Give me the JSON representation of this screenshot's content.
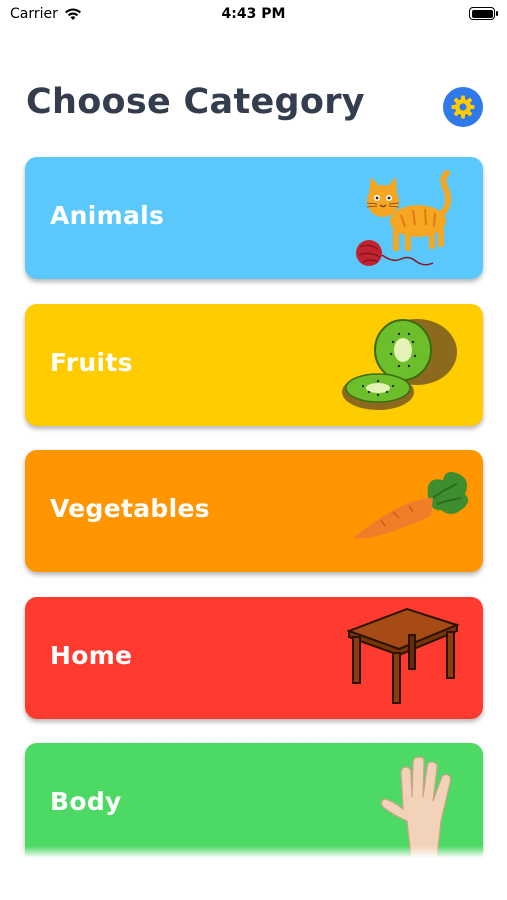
{
  "status_bar": {
    "carrier": "Carrier",
    "time": "4:43 PM"
  },
  "header": {
    "title": "Choose Category"
  },
  "categories": [
    {
      "label": "Animals",
      "color": "#5ac8fa",
      "icon": "cat-icon"
    },
    {
      "label": "Fruits",
      "color": "#ffcc00",
      "icon": "kiwi-icon"
    },
    {
      "label": "Vegetables",
      "color": "#ff9500",
      "icon": "carrot-icon"
    },
    {
      "label": "Home",
      "color": "#ff3b30",
      "icon": "table-icon"
    },
    {
      "label": "Body",
      "color": "#4cd964",
      "icon": "hand-icon"
    }
  ],
  "colors": {
    "title": "#333d4d",
    "settings_button": "#2f79ea",
    "settings_gear": "#ffcc00"
  }
}
